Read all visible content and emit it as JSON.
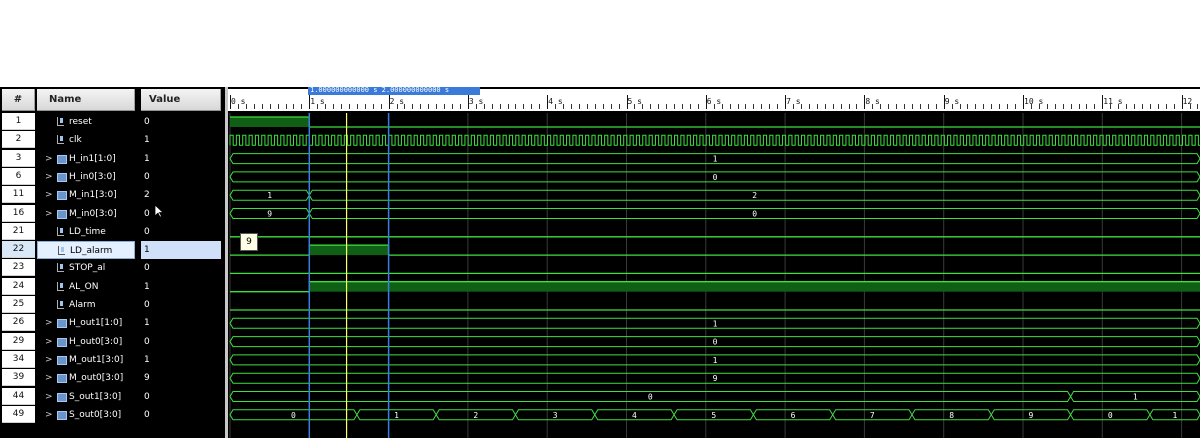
{
  "headers": {
    "num": "#",
    "name": "Name",
    "value": "Value"
  },
  "signals": [
    {
      "num": "1",
      "name": "reset",
      "value": "0",
      "bus": false
    },
    {
      "num": "2",
      "name": "clk",
      "value": "1",
      "bus": false
    },
    {
      "num": "3",
      "name": "H_in1[1:0]",
      "value": "1",
      "bus": true
    },
    {
      "num": "6",
      "name": "H_in0[3:0]",
      "value": "0",
      "bus": true
    },
    {
      "num": "11",
      "name": "M_in1[3:0]",
      "value": "2",
      "bus": true
    },
    {
      "num": "16",
      "name": "M_in0[3:0]",
      "value": "0",
      "bus": true
    },
    {
      "num": "21",
      "name": "LD_time",
      "value": "0",
      "bus": false
    },
    {
      "num": "22",
      "name": "LD_alarm",
      "value": "1",
      "bus": false,
      "selected": true
    },
    {
      "num": "23",
      "name": "STOP_al",
      "value": "0",
      "bus": false
    },
    {
      "num": "24",
      "name": "AL_ON",
      "value": "1",
      "bus": false
    },
    {
      "num": "25",
      "name": "Alarm",
      "value": "0",
      "bus": false
    },
    {
      "num": "26",
      "name": "H_out1[1:0]",
      "value": "1",
      "bus": true
    },
    {
      "num": "29",
      "name": "H_out0[3:0]",
      "value": "0",
      "bus": true
    },
    {
      "num": "34",
      "name": "M_out1[3:0]",
      "value": "1",
      "bus": true
    },
    {
      "num": "39",
      "name": "M_out0[3:0]",
      "value": "9",
      "bus": true
    },
    {
      "num": "44",
      "name": "S_out1[3:0]",
      "value": "0",
      "bus": true
    },
    {
      "num": "49",
      "name": "S_out0[3:0]",
      "value": "0",
      "bus": true
    }
  ],
  "ruler": {
    "tick_labels": [
      "0 s",
      "1 s",
      "2 s",
      "3 s",
      "4 s",
      "5 s",
      "6 s",
      "7 s",
      "8 s",
      "9 s",
      "10 s",
      "11 s",
      "12"
    ],
    "marker_label": "1.000000000000 s 2.000000000000 s"
  },
  "bus_values": {
    "H_in1": [
      "1"
    ],
    "H_in0": [
      "0"
    ],
    "M_in1": [
      "1",
      "2"
    ],
    "M_in0": [
      "9",
      "0"
    ],
    "H_out1": [
      "1"
    ],
    "H_out0": [
      "0"
    ],
    "M_out1": [
      "1"
    ],
    "M_out0": [
      "9"
    ],
    "S_out1": [
      "0",
      "1"
    ],
    "S_out0": [
      "0",
      "1",
      "2",
      "3",
      "4",
      "5",
      "6",
      "7",
      "8",
      "9",
      "0",
      "1"
    ]
  },
  "tooltip_value": "9",
  "colors": {
    "wave": "#3ee03e",
    "fill": "#0f5f15",
    "cursor_blue": "#3b7de0",
    "cursor_yellow": "#ffff66",
    "background": "#000000"
  },
  "icons": {
    "bit": "bit-signal-icon",
    "bus": "bus-signal-icon",
    "expand": "chevron-right-icon"
  }
}
